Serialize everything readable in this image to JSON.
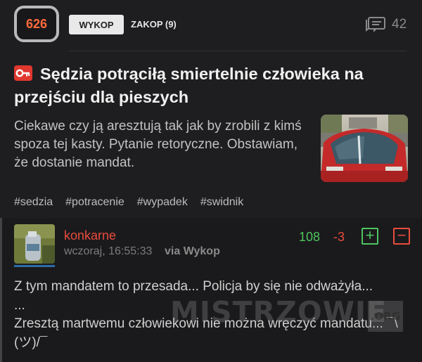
{
  "entry": {
    "votes": "626",
    "wykop_label": "WYKOP",
    "zakop_label": "ZAKOP (9)",
    "comments_count": "42",
    "title": "Sędzia potrąciłą smiertelnie człowieka na przejściu dla pieszych",
    "title_icon": "key-icon",
    "description": "Ciekawe czy ją aresztują tak jak by zrobili z kimś spoza tej kasty. Pytanie retoryczne. Obstawiam, że dostanie mandat.",
    "tags": [
      "#sedzia",
      "#potracenie",
      "#wypadek",
      "#swidnik"
    ]
  },
  "comment": {
    "username": "konkarne",
    "timestamp": "wczoraj, 16:55:33",
    "via": "via Wykop",
    "plus_votes": "108",
    "minus_votes": "-3",
    "plus_symbol": "+",
    "minus_symbol": "−",
    "text": "Z tym mandatem to przesada... Policja by się nie odważyła...\n...\nZresztą martwemu człowiekowi nie można wręczyć mandatu... ¯\\(ツ)/¯"
  },
  "watermark": {
    "text": "MISTRZOWIE",
    "suffix": ".ORG"
  },
  "colors": {
    "vote_orange": "#ff6b3d",
    "username_red": "#e84c3d",
    "plus_green": "#4fc45f",
    "background": "#1e1e20"
  }
}
